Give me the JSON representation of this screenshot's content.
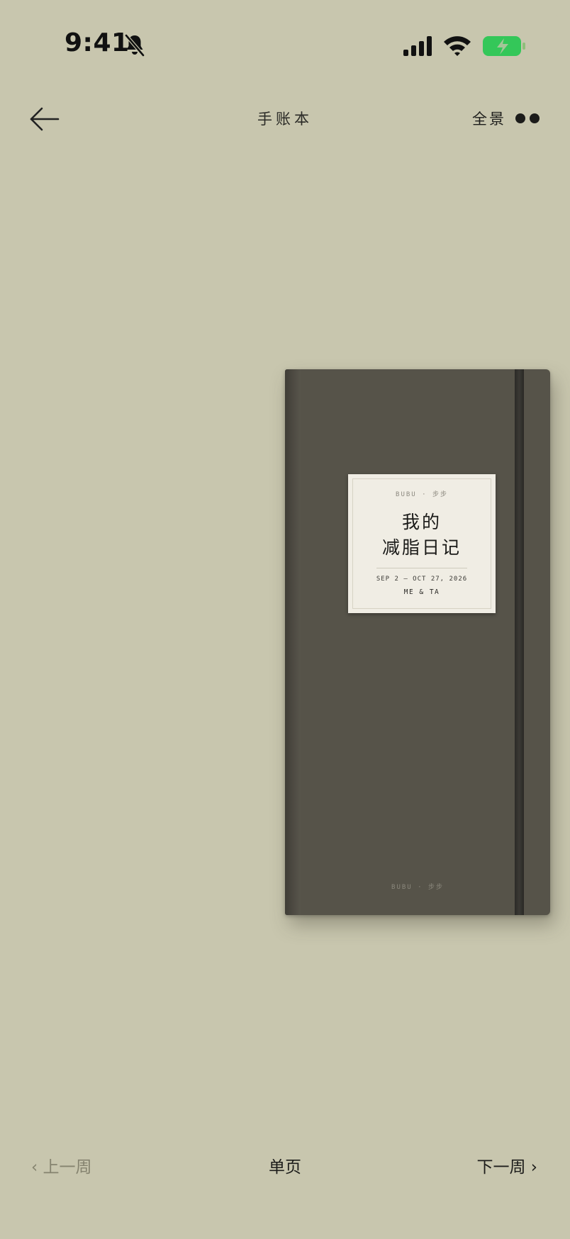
{
  "status_bar": {
    "time": "9:41",
    "icons": [
      "bell-slash-icon",
      "cellular-signal-icon",
      "wifi-icon",
      "battery-charging-icon"
    ],
    "battery_color": "#34c759"
  },
  "header": {
    "back_icon": "arrow-left-icon",
    "title": "手账本",
    "overview_label": "全景",
    "more_icon": "two-dots-icon"
  },
  "notebook": {
    "cover_color": "#565349",
    "label": {
      "brand": "BUBU · 步步",
      "title_line1": "我的",
      "title_line2": "减脂日记",
      "date_range": "SEP 2 — OCT 27, 2026",
      "people": "ME & TA"
    },
    "footer_brand": "BUBU · 步步"
  },
  "bottom_nav": {
    "prev_label": "‹ 上一周",
    "center_label": "单页",
    "next_label": "下一周 ›"
  },
  "colors": {
    "background": "#c8c6ae",
    "text_primary": "#1c1c1a",
    "text_disabled": "#85836f"
  }
}
